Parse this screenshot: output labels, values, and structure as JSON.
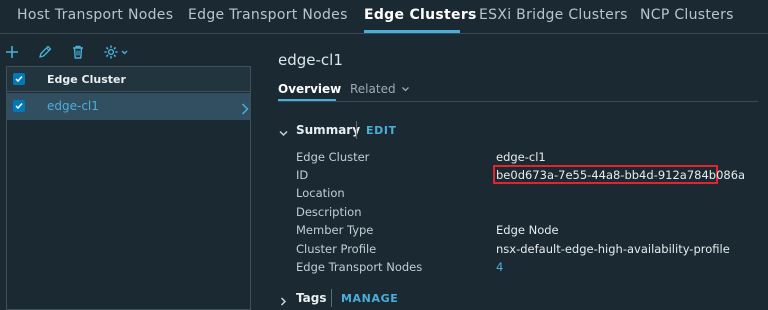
{
  "top_tabs": [
    {
      "label": "Host Transport Nodes"
    },
    {
      "label": "Edge Transport Nodes"
    },
    {
      "label": "Edge Clusters"
    },
    {
      "label": "ESXi Bridge Clusters"
    },
    {
      "label": "NCP Clusters"
    }
  ],
  "toolbar": {
    "add_icon": "plus-icon",
    "edit_icon": "pencil-icon",
    "delete_icon": "trash-icon",
    "actions_icon": "gear-icon"
  },
  "grid": {
    "header": "Edge Cluster",
    "rows": [
      {
        "name": "edge-cl1"
      }
    ]
  },
  "detail": {
    "title": "edge-cl1",
    "tabs": [
      {
        "label": "Overview"
      },
      {
        "label": "Related"
      }
    ],
    "summary": {
      "title": "Summary",
      "action": "EDIT",
      "properties": [
        {
          "label": "Edge Cluster",
          "value": "edge-cl1"
        },
        {
          "label": "ID",
          "value": "be0d673a-7e55-44a8-bb4d-912a784b086a"
        },
        {
          "label": "Location",
          "value": ""
        },
        {
          "label": "Description",
          "value": ""
        },
        {
          "label": "Member Type",
          "value": "Edge Node"
        },
        {
          "label": "Cluster Profile",
          "value": "nsx-default-edge-high-availability-profile"
        },
        {
          "label": "Edge Transport Nodes",
          "value": "4"
        }
      ]
    },
    "tags": {
      "title": "Tags",
      "action": "MANAGE"
    }
  },
  "colors": {
    "background": "#1b2a32",
    "accent": "#49afd9",
    "highlight_box": "#e0262b",
    "selected_row": "#324f61"
  }
}
